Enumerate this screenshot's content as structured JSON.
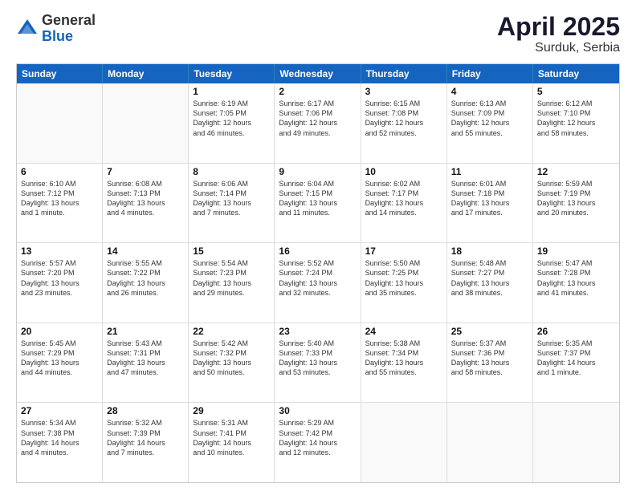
{
  "logo": {
    "general": "General",
    "blue": "Blue"
  },
  "title": "April 2025",
  "subtitle": "Surduk, Serbia",
  "header_days": [
    "Sunday",
    "Monday",
    "Tuesday",
    "Wednesday",
    "Thursday",
    "Friday",
    "Saturday"
  ],
  "weeks": [
    [
      {
        "day": "",
        "text": ""
      },
      {
        "day": "",
        "text": ""
      },
      {
        "day": "1",
        "text": "Sunrise: 6:19 AM\nSunset: 7:05 PM\nDaylight: 12 hours\nand 46 minutes."
      },
      {
        "day": "2",
        "text": "Sunrise: 6:17 AM\nSunset: 7:06 PM\nDaylight: 12 hours\nand 49 minutes."
      },
      {
        "day": "3",
        "text": "Sunrise: 6:15 AM\nSunset: 7:08 PM\nDaylight: 12 hours\nand 52 minutes."
      },
      {
        "day": "4",
        "text": "Sunrise: 6:13 AM\nSunset: 7:09 PM\nDaylight: 12 hours\nand 55 minutes."
      },
      {
        "day": "5",
        "text": "Sunrise: 6:12 AM\nSunset: 7:10 PM\nDaylight: 12 hours\nand 58 minutes."
      }
    ],
    [
      {
        "day": "6",
        "text": "Sunrise: 6:10 AM\nSunset: 7:12 PM\nDaylight: 13 hours\nand 1 minute."
      },
      {
        "day": "7",
        "text": "Sunrise: 6:08 AM\nSunset: 7:13 PM\nDaylight: 13 hours\nand 4 minutes."
      },
      {
        "day": "8",
        "text": "Sunrise: 6:06 AM\nSunset: 7:14 PM\nDaylight: 13 hours\nand 7 minutes."
      },
      {
        "day": "9",
        "text": "Sunrise: 6:04 AM\nSunset: 7:15 PM\nDaylight: 13 hours\nand 11 minutes."
      },
      {
        "day": "10",
        "text": "Sunrise: 6:02 AM\nSunset: 7:17 PM\nDaylight: 13 hours\nand 14 minutes."
      },
      {
        "day": "11",
        "text": "Sunrise: 6:01 AM\nSunset: 7:18 PM\nDaylight: 13 hours\nand 17 minutes."
      },
      {
        "day": "12",
        "text": "Sunrise: 5:59 AM\nSunset: 7:19 PM\nDaylight: 13 hours\nand 20 minutes."
      }
    ],
    [
      {
        "day": "13",
        "text": "Sunrise: 5:57 AM\nSunset: 7:20 PM\nDaylight: 13 hours\nand 23 minutes."
      },
      {
        "day": "14",
        "text": "Sunrise: 5:55 AM\nSunset: 7:22 PM\nDaylight: 13 hours\nand 26 minutes."
      },
      {
        "day": "15",
        "text": "Sunrise: 5:54 AM\nSunset: 7:23 PM\nDaylight: 13 hours\nand 29 minutes."
      },
      {
        "day": "16",
        "text": "Sunrise: 5:52 AM\nSunset: 7:24 PM\nDaylight: 13 hours\nand 32 minutes."
      },
      {
        "day": "17",
        "text": "Sunrise: 5:50 AM\nSunset: 7:25 PM\nDaylight: 13 hours\nand 35 minutes."
      },
      {
        "day": "18",
        "text": "Sunrise: 5:48 AM\nSunset: 7:27 PM\nDaylight: 13 hours\nand 38 minutes."
      },
      {
        "day": "19",
        "text": "Sunrise: 5:47 AM\nSunset: 7:28 PM\nDaylight: 13 hours\nand 41 minutes."
      }
    ],
    [
      {
        "day": "20",
        "text": "Sunrise: 5:45 AM\nSunset: 7:29 PM\nDaylight: 13 hours\nand 44 minutes."
      },
      {
        "day": "21",
        "text": "Sunrise: 5:43 AM\nSunset: 7:31 PM\nDaylight: 13 hours\nand 47 minutes."
      },
      {
        "day": "22",
        "text": "Sunrise: 5:42 AM\nSunset: 7:32 PM\nDaylight: 13 hours\nand 50 minutes."
      },
      {
        "day": "23",
        "text": "Sunrise: 5:40 AM\nSunset: 7:33 PM\nDaylight: 13 hours\nand 53 minutes."
      },
      {
        "day": "24",
        "text": "Sunrise: 5:38 AM\nSunset: 7:34 PM\nDaylight: 13 hours\nand 55 minutes."
      },
      {
        "day": "25",
        "text": "Sunrise: 5:37 AM\nSunset: 7:36 PM\nDaylight: 13 hours\nand 58 minutes."
      },
      {
        "day": "26",
        "text": "Sunrise: 5:35 AM\nSunset: 7:37 PM\nDaylight: 14 hours\nand 1 minute."
      }
    ],
    [
      {
        "day": "27",
        "text": "Sunrise: 5:34 AM\nSunset: 7:38 PM\nDaylight: 14 hours\nand 4 minutes."
      },
      {
        "day": "28",
        "text": "Sunrise: 5:32 AM\nSunset: 7:39 PM\nDaylight: 14 hours\nand 7 minutes."
      },
      {
        "day": "29",
        "text": "Sunrise: 5:31 AM\nSunset: 7:41 PM\nDaylight: 14 hours\nand 10 minutes."
      },
      {
        "day": "30",
        "text": "Sunrise: 5:29 AM\nSunset: 7:42 PM\nDaylight: 14 hours\nand 12 minutes."
      },
      {
        "day": "",
        "text": ""
      },
      {
        "day": "",
        "text": ""
      },
      {
        "day": "",
        "text": ""
      }
    ]
  ]
}
